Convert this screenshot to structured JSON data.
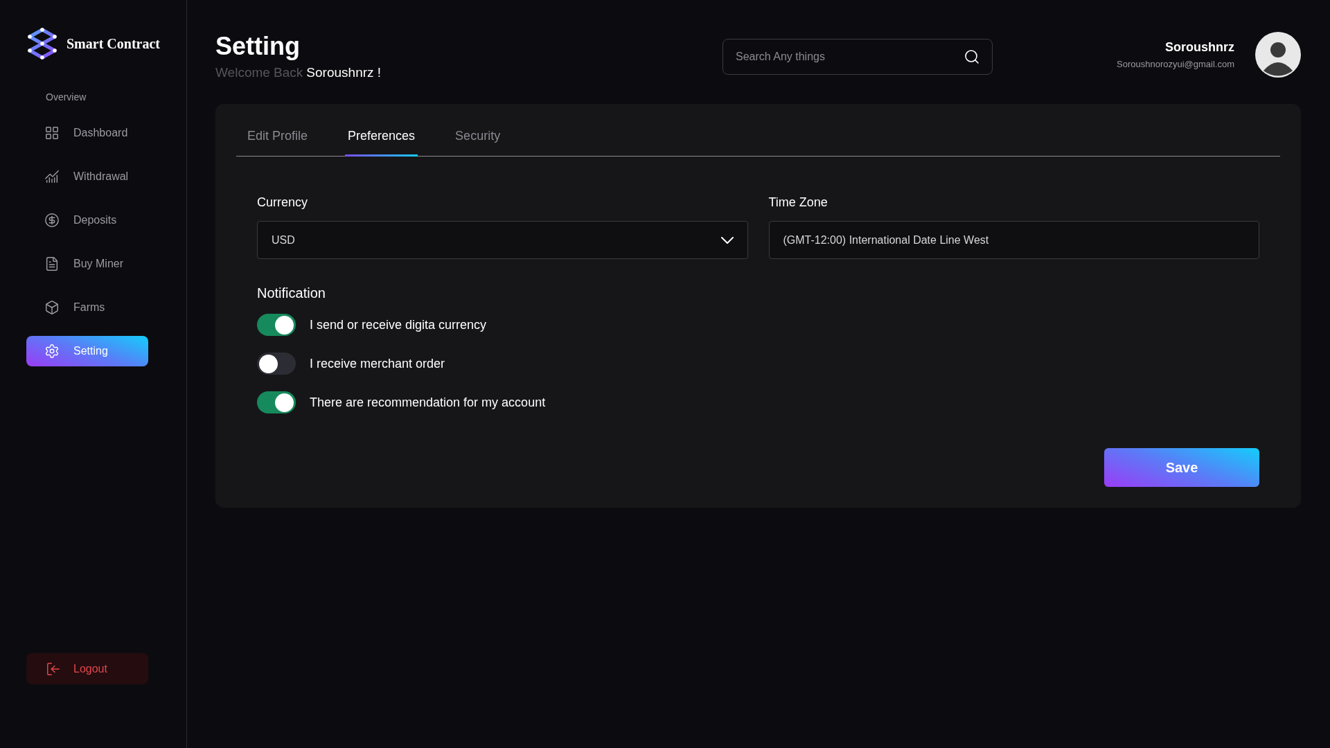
{
  "sidebar": {
    "brand": "Smart Contract",
    "section_label": "Overview",
    "items": [
      {
        "label": "Dashboard",
        "selected": false
      },
      {
        "label": "Withdrawal",
        "selected": false
      },
      {
        "label": "Deposits",
        "selected": false
      },
      {
        "label": "Buy Miner",
        "selected": false
      },
      {
        "label": "Farms",
        "selected": false
      },
      {
        "label": "Setting",
        "selected": true
      }
    ],
    "logout": "Logout"
  },
  "header": {
    "title": "Setting",
    "welcome": "Welcome Back",
    "username": "Soroushnrz !",
    "search": {
      "placeholder": "Search Any things"
    },
    "user": {
      "name": "Soroushnrz",
      "email": "Soroushnorozyui@gmail.com"
    }
  },
  "tabs": [
    {
      "label": "Edit Profile",
      "selected": false
    },
    {
      "label": "Preferences",
      "selected": true
    },
    {
      "label": "Security",
      "selected": false
    }
  ],
  "fields": [
    {
      "label": "Currency",
      "value": "USD",
      "kind": "dropdown"
    },
    {
      "label": "Time Zone",
      "value": "(GMT-12:00) International Date Line West",
      "kind": "text"
    }
  ],
  "notification": {
    "title": "Notification",
    "options": [
      {
        "label": "I send or receive digita currency",
        "on": true
      },
      {
        "label": "I receive merchant order",
        "on": false
      },
      {
        "label": "There are recommendation for my account",
        "on": true
      }
    ]
  },
  "save_button": "Save"
}
